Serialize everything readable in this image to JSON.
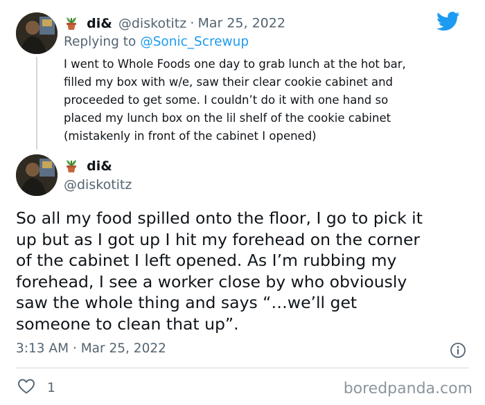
{
  "reply_tweet": {
    "display_name": "di&",
    "handle": "@diskotitz",
    "separator": "·",
    "date": "Mar 25, 2022",
    "replying_to_prefix": "Replying to ",
    "replying_to_handle": "@Sonic_Screwup",
    "text_lines": [
      "I went to Whole Foods one day to grab lunch at the hot bar,",
      "filled my box with w/e, saw their clear cookie cabinet and",
      "proceeded to get some. I couldn’t do it with one hand so",
      "placed my lunch box on the lil shelf of the cookie cabinet",
      "(mistakenly in front of the cabinet I opened)"
    ]
  },
  "main_tweet": {
    "display_name": "di&",
    "handle": "@diskotitz",
    "text_lines": [
      "So all my food spilled onto the floor, I go to pick it",
      "up but as I got up I hit my forehead on the corner",
      "of the cabinet I left opened. As I’m rubbing my",
      "forehead, I see a worker close by who obviously",
      "saw the whole thing and says “…we’ll get",
      "someone to clean that up”."
    ],
    "time": "3:13 AM",
    "separator": "·",
    "date": "Mar 25, 2022",
    "like_count": "1"
  },
  "icons": {
    "name_emoji": "potted-plant-icon",
    "brand": "twitter-bird-icon",
    "info": "info-icon",
    "like": "heart-outline-icon"
  },
  "colors": {
    "twitter_blue": "#1d9bf0",
    "reply_link": "#1d9bf0",
    "secondary_text": "#536471",
    "divider": "#cfd9de"
  },
  "watermark": "boredpanda.com"
}
